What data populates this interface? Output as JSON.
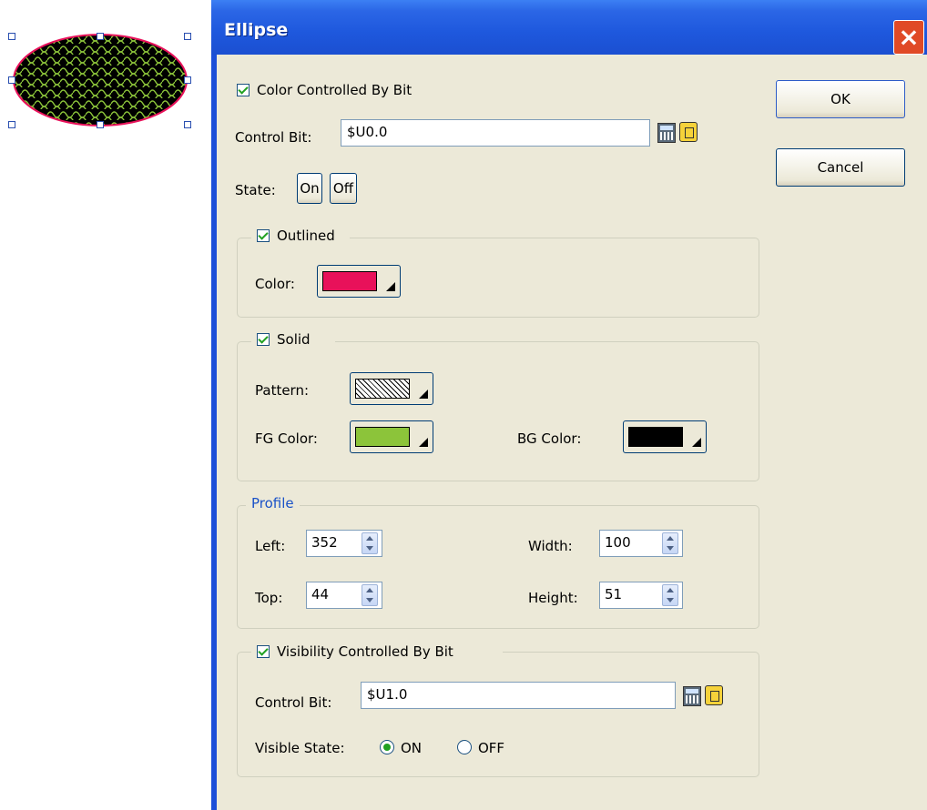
{
  "dialog": {
    "title": "Ellipse",
    "buttons": {
      "ok": "OK",
      "cancel": "Cancel"
    }
  },
  "color_control": {
    "checkbox_label": "Color Controlled By Bit",
    "control_bit_label": "Control Bit:",
    "control_bit_value": "$U0.0",
    "state_label": "State:",
    "state_on": "On",
    "state_off": "Off"
  },
  "outlined": {
    "label": "Outlined",
    "color_label": "Color:",
    "color": "#e8115a"
  },
  "solid": {
    "label": "Solid",
    "pattern_label": "Pattern:",
    "fg_label": "FG Color:",
    "fg_color": "#8cc43a",
    "bg_label": "BG Color:",
    "bg_color": "#000000"
  },
  "profile": {
    "label": "Profile",
    "left_label": "Left:",
    "left": "352",
    "top_label": "Top:",
    "top": "44",
    "width_label": "Width:",
    "width": "100",
    "height_label": "Height:",
    "height": "51"
  },
  "visibility": {
    "checkbox_label": "Visibility Controlled By Bit",
    "control_bit_label": "Control Bit:",
    "control_bit_value": "$U1.0",
    "visible_state_label": "Visible State:",
    "option_on": "ON",
    "option_off": "OFF",
    "selected": "ON"
  }
}
